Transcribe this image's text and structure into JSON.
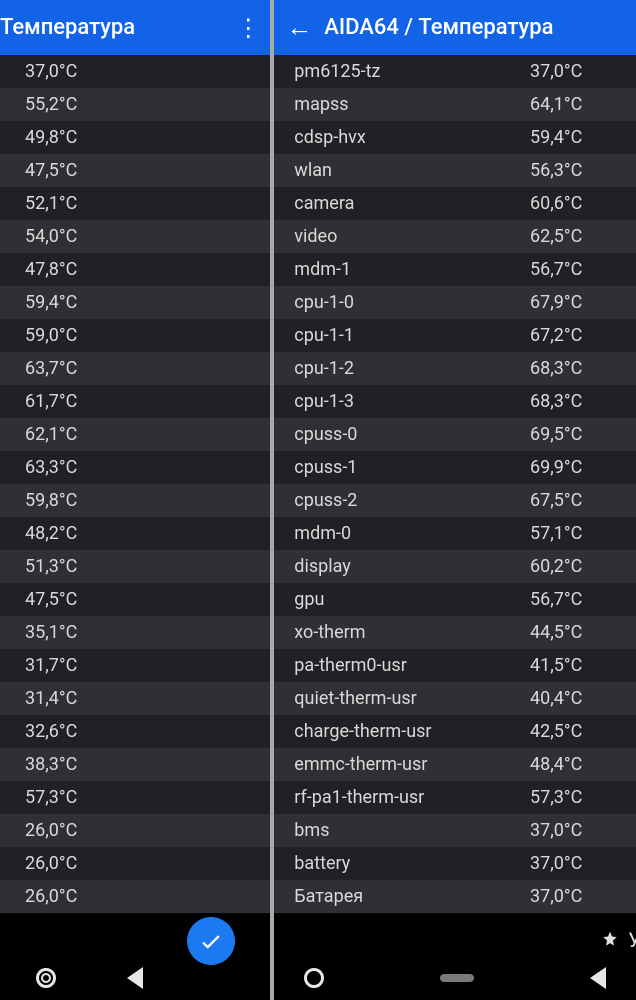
{
  "left": {
    "title": "Температура",
    "rows": [
      {
        "label": "",
        "value": "37,0°C"
      },
      {
        "label": "",
        "value": "55,2°C"
      },
      {
        "label": "",
        "value": "49,8°C"
      },
      {
        "label": "",
        "value": "47,5°C"
      },
      {
        "label": "",
        "value": "52,1°C"
      },
      {
        "label": "",
        "value": "54,0°C"
      },
      {
        "label": "",
        "value": "47,8°C"
      },
      {
        "label": "",
        "value": "59,4°C"
      },
      {
        "label": "",
        "value": "59,0°C"
      },
      {
        "label": "",
        "value": "63,7°C"
      },
      {
        "label": "",
        "value": "61,7°C"
      },
      {
        "label": "",
        "value": "62,1°C"
      },
      {
        "label": "",
        "value": "63,3°C"
      },
      {
        "label": "",
        "value": "59,8°C"
      },
      {
        "label": "",
        "value": "48,2°C"
      },
      {
        "label": "",
        "value": "51,3°C"
      },
      {
        "label": "",
        "value": "47,5°C"
      },
      {
        "label": "",
        "value": "35,1°C"
      },
      {
        "label": "",
        "value": "31,7°C"
      },
      {
        "label": "",
        "value": "31,4°C"
      },
      {
        "label": "",
        "value": "32,6°C"
      },
      {
        "label": "",
        "value": "38,3°C"
      },
      {
        "label": "",
        "value": "57,3°C"
      },
      {
        "label": "",
        "value": "26,0°C"
      },
      {
        "label": "",
        "value": "26,0°C"
      },
      {
        "label": "",
        "value": "26,0°C"
      }
    ]
  },
  "right": {
    "title": "AIDA64  /  Температура",
    "rows": [
      {
        "label": "pm6125-tz",
        "value": "37,0°C"
      },
      {
        "label": "mapss",
        "value": "64,1°C"
      },
      {
        "label": "cdsp-hvx",
        "value": "59,4°C"
      },
      {
        "label": "wlan",
        "value": "56,3°C"
      },
      {
        "label": "camera",
        "value": "60,6°C"
      },
      {
        "label": "video",
        "value": "62,5°C"
      },
      {
        "label": "mdm-1",
        "value": "56,7°C"
      },
      {
        "label": "cpu-1-0",
        "value": "67,9°C"
      },
      {
        "label": "cpu-1-1",
        "value": "67,2°C"
      },
      {
        "label": "cpu-1-2",
        "value": "68,3°C"
      },
      {
        "label": "cpu-1-3",
        "value": "68,3°C"
      },
      {
        "label": "cpuss-0",
        "value": "69,5°C"
      },
      {
        "label": "cpuss-1",
        "value": "69,9°C"
      },
      {
        "label": "cpuss-2",
        "value": "67,5°C"
      },
      {
        "label": "mdm-0",
        "value": "57,1°C"
      },
      {
        "label": "display",
        "value": "60,2°C"
      },
      {
        "label": "gpu",
        "value": "56,7°C"
      },
      {
        "label": "xo-therm",
        "value": "44,5°C"
      },
      {
        "label": "pa-therm0-usr",
        "value": "41,5°C"
      },
      {
        "label": "quiet-therm-usr",
        "value": "40,4°C"
      },
      {
        "label": "charge-therm-usr",
        "value": "42,5°C"
      },
      {
        "label": "emmc-therm-usr",
        "value": "48,4°C"
      },
      {
        "label": "rf-pa1-therm-usr",
        "value": "57,3°C"
      },
      {
        "label": "bms",
        "value": "37,0°C"
      },
      {
        "label": "battery",
        "value": "37,0°C"
      },
      {
        "label": "Батарея",
        "value": "37,0°C"
      }
    ]
  },
  "pill": {
    "label": "Улучшение"
  }
}
